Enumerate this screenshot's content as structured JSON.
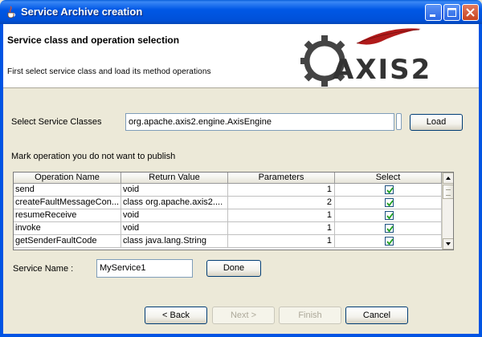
{
  "window": {
    "title": "Service Archive creation",
    "icon": "java-cup-icon",
    "controls": [
      "minimize-icon",
      "maximize-icon",
      "close-icon"
    ]
  },
  "header": {
    "title": "Service class and operation selection",
    "subtitle": "First select service class and load its method operations",
    "logo_text": "AXIS2"
  },
  "service_classes": {
    "label": "Select Service Classes",
    "value": "org.apache.axis2.engine.AxisEngine",
    "browse_label": "",
    "load_label": "Load"
  },
  "operations": {
    "instruction": "Mark operation you do not want to publish",
    "columns": [
      "Operation Name",
      "Return Value",
      "Parameters",
      "Select"
    ],
    "rows": [
      {
        "name": "send",
        "return": "void",
        "params": "1",
        "selected": true
      },
      {
        "name": "createFaultMessageCon...",
        "return": "class org.apache.axis2....",
        "params": "2",
        "selected": true
      },
      {
        "name": "resumeReceive",
        "return": "void",
        "params": "1",
        "selected": true
      },
      {
        "name": "invoke",
        "return": "void",
        "params": "1",
        "selected": true
      },
      {
        "name": "getSenderFaultCode",
        "return": "class java.lang.String",
        "params": "1",
        "selected": true
      }
    ]
  },
  "service_name": {
    "label": "Service Name :",
    "value": "MyService1",
    "done_label": "Done"
  },
  "nav": {
    "back": "< Back",
    "next": "Next >",
    "finish": "Finish",
    "cancel": "Cancel"
  }
}
